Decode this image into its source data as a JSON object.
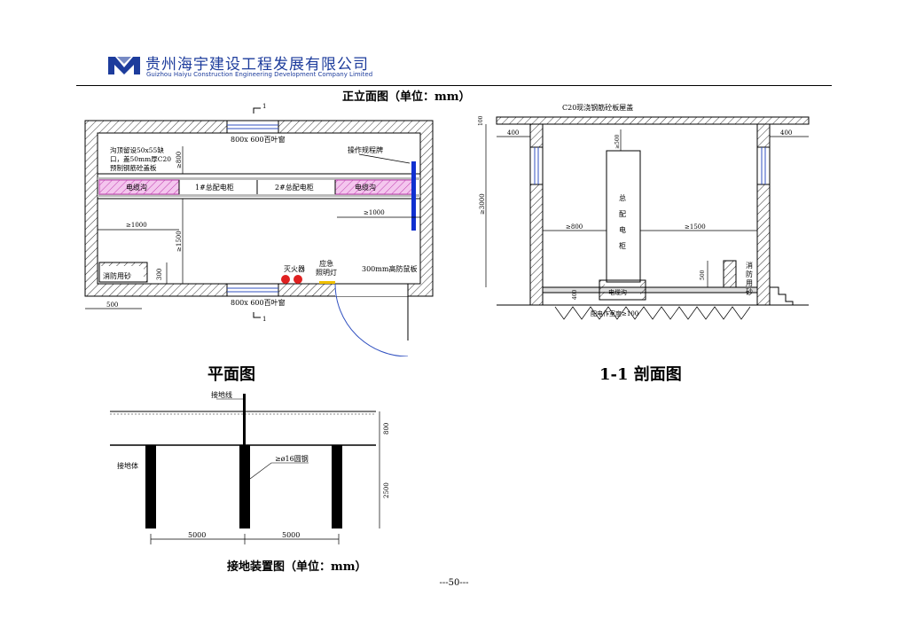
{
  "header": {
    "company_cn": "贵州海宇建设工程发展有限公司",
    "company_en": "Guizhou Haiyu Construction Engineering Development Company Limited",
    "brand_color": "#1d3c9c"
  },
  "top_caption": "正立面图（单位：mm）",
  "plan": {
    "title": "平面图",
    "window_label": "800x 600百叶窗",
    "window_label_bottom": "800x 600百叶窗",
    "section_mark_top": "1",
    "section_mark_bottom": "1",
    "trench_note_lines": [
      "沟顶留设50x55缺",
      "口，盖50mm厚C20",
      "预制钢筋砼盖板"
    ],
    "cable_trench_left": "电缆沟",
    "cable_trench_right": "电缆沟",
    "cabinet_1": "1#总配电柜",
    "cabinet_2": "2#总配电柜",
    "operation_sign": "操作规程牌",
    "dim_800": "≥800",
    "dim_1000_left": "≥1000",
    "dim_1000_right": "≥1000",
    "dim_1500": "≥1500",
    "dim_300": "300",
    "dim_500": "500",
    "fire_sand": "消防用砂",
    "extinguisher": "灭火器",
    "emergency_light_lines": [
      "应急",
      "照明灯"
    ],
    "rat_board": "300mm高防鼠板"
  },
  "section": {
    "title": "1-1 剖面图",
    "roof_label": "C20现浇钢筋砼板屋盖",
    "dim_400_left": "400",
    "dim_400_right": "400",
    "dim_100_top": "100",
    "dim_3000": "≥3000",
    "dim_500_top": "≥500",
    "cabinet_chars": [
      "总",
      "配",
      "电",
      "柜"
    ],
    "dim_800": "≥800",
    "dim_1500": "≥1500",
    "dim_500_side": "500",
    "fire_sand_chars": [
      "消",
      "防",
      "用",
      "砂"
    ],
    "trench_label": "电缆沟",
    "dim_trench": "400",
    "floor_label": "配电作室度≥100"
  },
  "grounding": {
    "title": "接地装置图（单位：mm）",
    "ground_wire": "接地线",
    "ground_body": "接地体",
    "rebar": "≥ø16圆钢",
    "dim_800": "800",
    "dim_2500": "2500",
    "dim_5000_a": "5000",
    "dim_5000_b": "5000"
  },
  "page_number": "---50---"
}
